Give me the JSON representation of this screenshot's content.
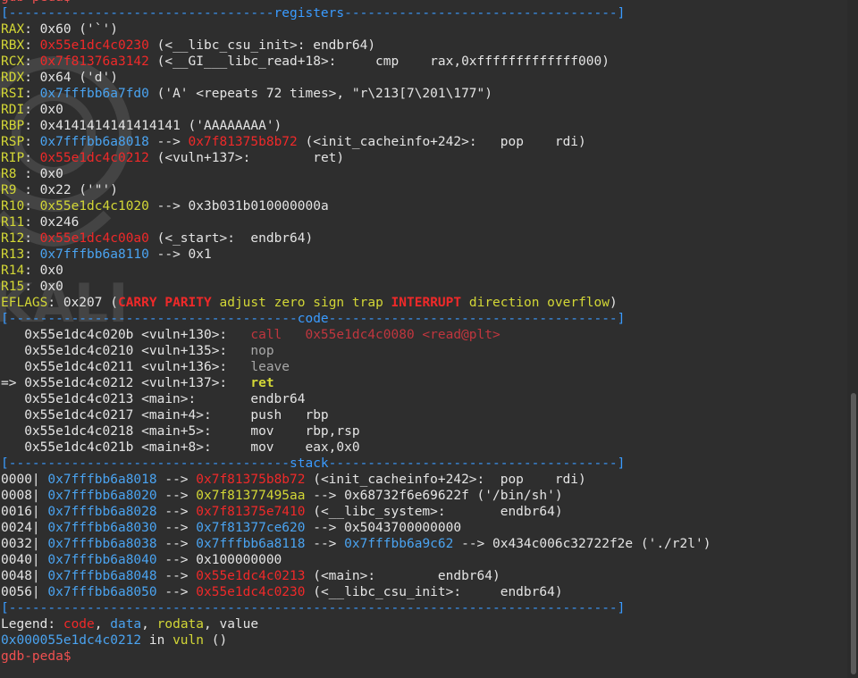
{
  "app": "gdb-peda",
  "colors": {
    "background": "#2e2e2e",
    "text": "#e4e4e4",
    "yellow": "#d3d736",
    "red": "#ef2929",
    "blue": "#4aa3f0",
    "grey": "#a8a8a8"
  },
  "watermark_text": "KALI",
  "lines": [
    [
      [
        "gdb-peda$",
        "rt"
      ]
    ],
    [
      [
        "[----------------------------------registers-----------------------------------]",
        "bb"
      ]
    ],
    [
      [
        "RAX",
        "y"
      ],
      [
        ": 0x60 ('`')",
        "w"
      ]
    ],
    [
      [
        "RBX",
        "y"
      ],
      [
        ": ",
        "w"
      ],
      [
        "0x55e1dc4c0230",
        "r"
      ],
      [
        " (<__libc_csu_init>: endbr64)",
        "w"
      ]
    ],
    [
      [
        "RCX",
        "y"
      ],
      [
        ": ",
        "w"
      ],
      [
        "0x7f81376a3142",
        "r"
      ],
      [
        " (<__GI___libc_read+18>:     cmp    rax,0xfffffffffffff000)",
        "w"
      ]
    ],
    [
      [
        "RDX",
        "y"
      ],
      [
        ": 0x64 ('d')",
        "w"
      ]
    ],
    [
      [
        "RSI",
        "y"
      ],
      [
        ": ",
        "w"
      ],
      [
        "0x7fffbb6a7fd0",
        "b"
      ],
      [
        " ('A' <repeats 72 times>, \"r\\213[7\\201\\177\")",
        "w"
      ]
    ],
    [
      [
        "RDI",
        "y"
      ],
      [
        ": 0x0",
        "w"
      ]
    ],
    [
      [
        "RBP",
        "y"
      ],
      [
        ": 0x4141414141414141 ('AAAAAAAA')",
        "w"
      ]
    ],
    [
      [
        "RSP",
        "y"
      ],
      [
        ": ",
        "w"
      ],
      [
        "0x7fffbb6a8018",
        "b"
      ],
      [
        " --> ",
        "w"
      ],
      [
        "0x7f81375b8b72",
        "r"
      ],
      [
        " (<init_cacheinfo+242>:   pop    rdi)",
        "w"
      ]
    ],
    [
      [
        "RIP",
        "y"
      ],
      [
        ": ",
        "w"
      ],
      [
        "0x55e1dc4c0212",
        "r"
      ],
      [
        " (<vuln+137>:        ret)",
        "w"
      ]
    ],
    [
      [
        "R8 ",
        "y"
      ],
      [
        ": 0x0",
        "w"
      ]
    ],
    [
      [
        "R9 ",
        "y"
      ],
      [
        ": 0x22 ('\"')",
        "w"
      ]
    ],
    [
      [
        "R10",
        "y"
      ],
      [
        ": ",
        "w"
      ],
      [
        "0x55e1dc4c1020",
        "y"
      ],
      [
        " --> 0x3b031b010000000a",
        "w"
      ]
    ],
    [
      [
        "R11",
        "y"
      ],
      [
        ": 0x246",
        "w"
      ]
    ],
    [
      [
        "R12",
        "y"
      ],
      [
        ": ",
        "w"
      ],
      [
        "0x55e1dc4c00a0",
        "r"
      ],
      [
        " (<_start>:  endbr64)",
        "w"
      ]
    ],
    [
      [
        "R13",
        "y"
      ],
      [
        ": ",
        "w"
      ],
      [
        "0x7fffbb6a8110",
        "b"
      ],
      [
        " --> 0x1",
        "w"
      ]
    ],
    [
      [
        "R14",
        "y"
      ],
      [
        ": 0x0",
        "w"
      ]
    ],
    [
      [
        "R15",
        "y"
      ],
      [
        ": 0x0",
        "w"
      ]
    ],
    [
      [
        "EFLAGS",
        "y"
      ],
      [
        ": 0x207 (",
        "w"
      ],
      [
        "CARRY",
        "r",
        true
      ],
      [
        " ",
        "w"
      ],
      [
        "PARITY",
        "r",
        true
      ],
      [
        " adjust zero sign trap ",
        "y"
      ],
      [
        "INTERRUPT",
        "r",
        true
      ],
      [
        " direction overflow",
        "y"
      ],
      [
        ")",
        "w"
      ]
    ],
    [
      [
        "[-------------------------------------code-------------------------------------]",
        "bb"
      ]
    ],
    [
      [
        "   0x55e1dc4c020b <vuln+130>:   ",
        "w"
      ],
      [
        "call   0x55e1dc4c0080 <read@plt>",
        "dr"
      ]
    ],
    [
      [
        "   0x55e1dc4c0210 <vuln+135>:   ",
        "w"
      ],
      [
        "nop",
        "g"
      ]
    ],
    [
      [
        "   0x55e1dc4c0211 <vuln+136>:   ",
        "w"
      ],
      [
        "leave",
        "g"
      ]
    ],
    [
      [
        "=> 0x55e1dc4c0212 <vuln+137>:   ",
        "w"
      ],
      [
        "ret",
        "y",
        true
      ]
    ],
    [
      [
        "   0x55e1dc4c0213 <main>:       endbr64",
        "w"
      ]
    ],
    [
      [
        "   0x55e1dc4c0217 <main+4>:     push   rbp",
        "w"
      ]
    ],
    [
      [
        "   0x55e1dc4c0218 <main+5>:     mov    rbp,rsp",
        "w"
      ]
    ],
    [
      [
        "   0x55e1dc4c021b <main+8>:     mov    eax,0x0",
        "w"
      ]
    ],
    [
      [
        "[------------------------------------stack-------------------------------------]",
        "bb"
      ]
    ],
    [
      [
        "0000| ",
        "w"
      ],
      [
        "0x7fffbb6a8018",
        "b"
      ],
      [
        " --> ",
        "w"
      ],
      [
        "0x7f81375b8b72",
        "r"
      ],
      [
        " (<init_cacheinfo+242>:  pop    rdi)",
        "w"
      ]
    ],
    [
      [
        "0008| ",
        "w"
      ],
      [
        "0x7fffbb6a8020",
        "b"
      ],
      [
        " --> ",
        "w"
      ],
      [
        "0x7f81377495aa",
        "y"
      ],
      [
        " --> 0x68732f6e69622f ('/bin/sh')",
        "w"
      ]
    ],
    [
      [
        "0016| ",
        "w"
      ],
      [
        "0x7fffbb6a8028",
        "b"
      ],
      [
        " --> ",
        "w"
      ],
      [
        "0x7f81375e7410",
        "r"
      ],
      [
        " (<__libc_system>:       endbr64)",
        "w"
      ]
    ],
    [
      [
        "0024| ",
        "w"
      ],
      [
        "0x7fffbb6a8030",
        "b"
      ],
      [
        " --> ",
        "w"
      ],
      [
        "0x7f81377ce620",
        "b"
      ],
      [
        " --> 0x5043700000000",
        "w"
      ]
    ],
    [
      [
        "0032| ",
        "w"
      ],
      [
        "0x7fffbb6a8038",
        "b"
      ],
      [
        " --> ",
        "w"
      ],
      [
        "0x7fffbb6a8118",
        "b"
      ],
      [
        " --> ",
        "w"
      ],
      [
        "0x7fffbb6a9c62",
        "b"
      ],
      [
        " --> 0x434c006c32722f2e ('./r2l')",
        "w"
      ]
    ],
    [
      [
        "0040| ",
        "w"
      ],
      [
        "0x7fffbb6a8040",
        "b"
      ],
      [
        " --> 0x100000000",
        "w"
      ]
    ],
    [
      [
        "0048| ",
        "w"
      ],
      [
        "0x7fffbb6a8048",
        "b"
      ],
      [
        " --> ",
        "w"
      ],
      [
        "0x55e1dc4c0213",
        "r"
      ],
      [
        " (<main>:        endbr64)",
        "w"
      ]
    ],
    [
      [
        "0056| ",
        "w"
      ],
      [
        "0x7fffbb6a8050",
        "b"
      ],
      [
        " --> ",
        "w"
      ],
      [
        "0x55e1dc4c0230",
        "r"
      ],
      [
        " (<__libc_csu_init>:     endbr64)",
        "w"
      ]
    ],
    [
      [
        "[------------------------------------------------------------------------------]",
        "bb"
      ]
    ],
    [
      [
        "Legend: ",
        "w"
      ],
      [
        "code",
        "r"
      ],
      [
        ", ",
        "w"
      ],
      [
        "data",
        "b"
      ],
      [
        ", ",
        "w"
      ],
      [
        "rodata",
        "y"
      ],
      [
        ", value",
        "w"
      ]
    ],
    [
      [
        "0x000055e1dc4c0212",
        "b"
      ],
      [
        " in ",
        "w"
      ],
      [
        "vuln",
        "y"
      ],
      [
        " ()",
        "w"
      ]
    ],
    [
      [
        "gdb-peda$",
        "rt"
      ]
    ]
  ]
}
